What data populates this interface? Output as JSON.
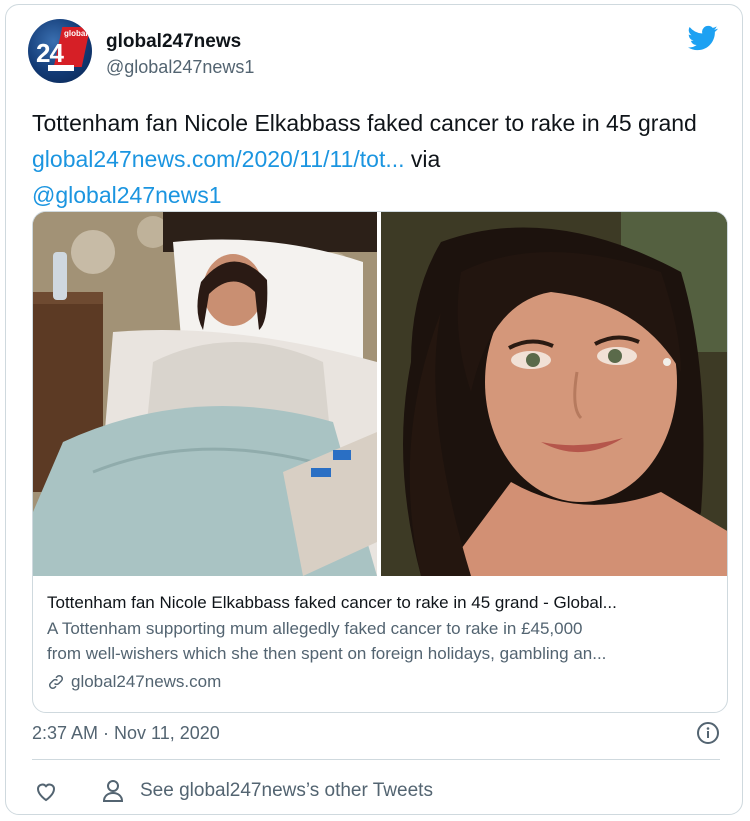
{
  "author": {
    "display_name": "global247news",
    "handle": "@global247news1",
    "avatar_text_top": "global",
    "avatar_text_num": "24"
  },
  "tweet": {
    "text_prefix": "Tottenham fan Nicole Elkabbass faked cancer to rake in 45 grand",
    "link_text": "global247news.com/2020/11/11/tot...",
    "via_text": "via",
    "mention": "@global247news1"
  },
  "link_card": {
    "title": "Tottenham fan Nicole Elkabbass faked cancer to rake in 45 grand - Global...",
    "description_line1": "A Tottenham supporting mum allegedly faked cancer to rake in £45,000",
    "description_line2": "from well-wishers which she then spent on foreign holidays, gambling an...",
    "domain": "global247news.com"
  },
  "meta": {
    "timestamp": "2:37 AM · Nov 11, 2020"
  },
  "actions": {
    "other_tweets_label": "See global247news’s other Tweets"
  },
  "colors": {
    "link": "#1b95e0",
    "twitter_blue": "#1da1f2",
    "secondary_text": "#536471",
    "border": "#cfd9de"
  },
  "icons": [
    "twitter-bird-icon",
    "info-icon",
    "link-icon",
    "heart-icon",
    "person-icon"
  ]
}
